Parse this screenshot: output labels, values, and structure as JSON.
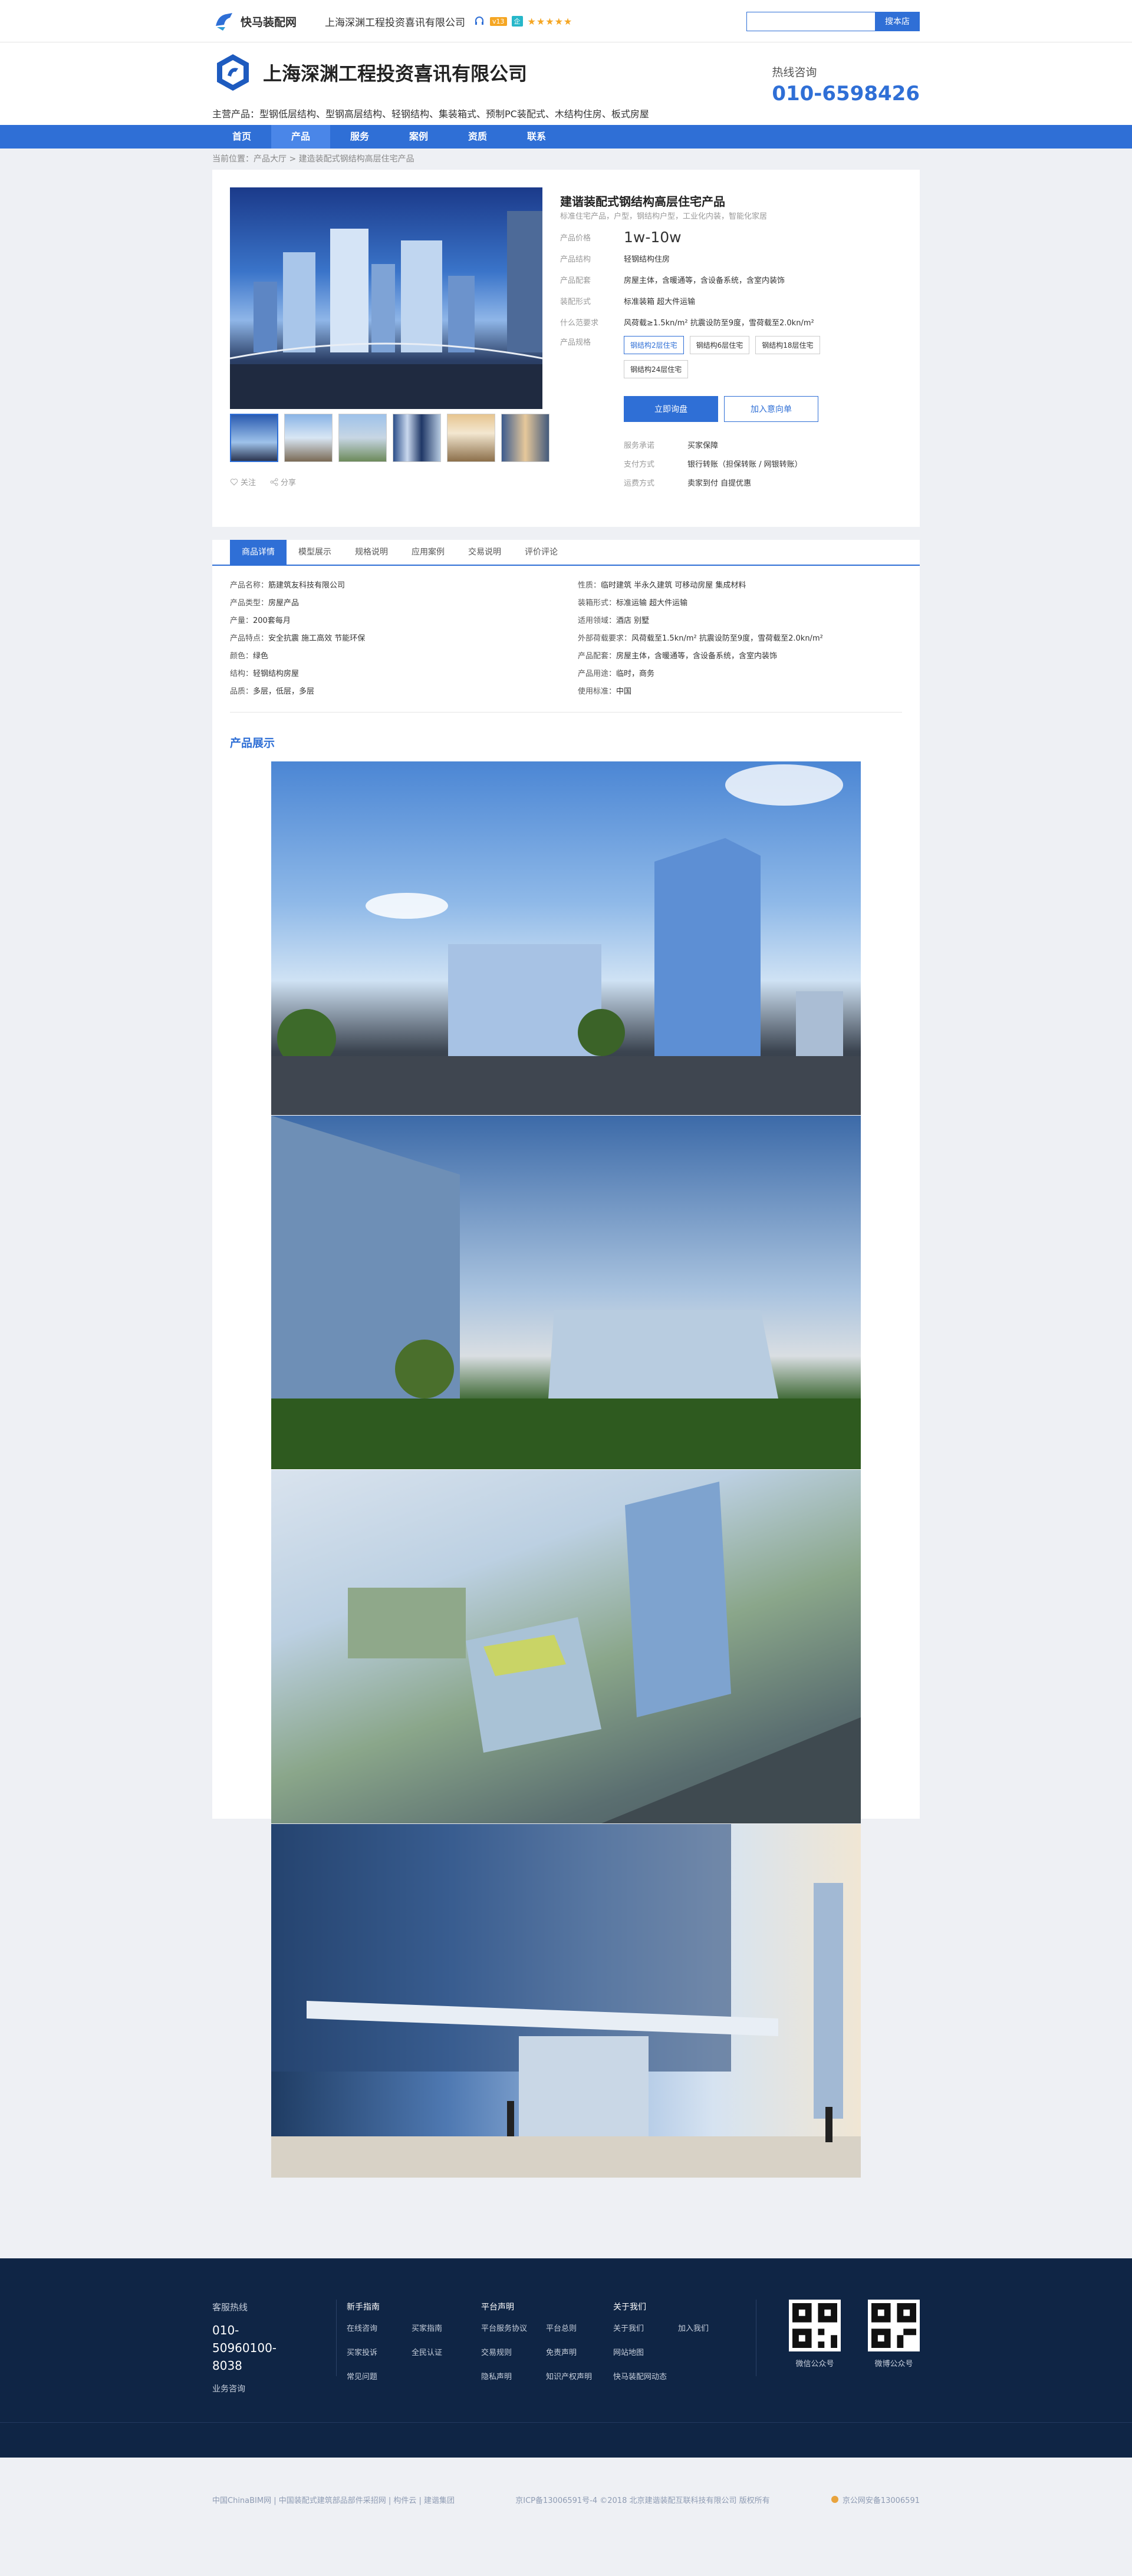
{
  "topbar": {
    "brand": "快马装配网",
    "company": "上海深渊工程投资喜讯有限公司",
    "v_badge": "v13",
    "c_badge": "企",
    "stars": "★★★★★",
    "search_placeholder": "",
    "search_button": "搜本店"
  },
  "header": {
    "company_name": "上海深渊工程投资喜讯有限公司",
    "main_products": "主营产品：型钢低层结构、型钢高层结构、轻钢结构、集装箱式、预制PC装配式、木结构住房、板式房屋",
    "hotline_label": "热线咨询",
    "hotline_number": "010-6598426"
  },
  "nav": [
    "首页",
    "产品",
    "服务",
    "案例",
    "资质",
    "联系"
  ],
  "breadcrumb": "当前位置：产品大厅 > 建造装配式钢结构高层住宅产品",
  "product": {
    "title": "建谐装配式钢结构高层住宅产品",
    "subtitle": "标准住宅产品，户型，钢结构户型，工业化内装，智能化家居",
    "rows": [
      {
        "k": "产品价格",
        "v": "1w-10w"
      },
      {
        "k": "产品结构",
        "v": "轻钢结构住房"
      },
      {
        "k": "产品配套",
        "v": "房屋主体，含暖通等，含设备系统，含室内装饰"
      },
      {
        "k": "装配形式",
        "v": "标准装箱   超大件运输"
      },
      {
        "k": "什么范要求",
        "v": "风荷载≥1.5kn/m²  抗震设防至9度，雪荷载至2.0kn/m²"
      }
    ],
    "spec_label": "产品规格",
    "specs": [
      "钢结构2层住宅",
      "钢结构6层住宅",
      "钢结构18层住宅",
      "钢结构24层住宅"
    ],
    "btn_contact": "立即询盘",
    "btn_cart": "加入意向单",
    "service": [
      {
        "k": "服务承诺",
        "v": "买家保障"
      },
      {
        "k": "支付方式",
        "v": "银行转账（担保转账 / 网银转账）"
      },
      {
        "k": "运费方式",
        "v": "卖家到付  自提优惠"
      }
    ],
    "follow": "关注",
    "share": "分享"
  },
  "tabs": [
    "商品详情",
    "模型展示",
    "规格说明",
    "应用案例",
    "交易说明",
    "评价评论"
  ],
  "attrs": [
    {
      "k": "产品名称：",
      "v": "筋建筑友科技有限公司"
    },
    {
      "k": "性质：",
      "v": "临时建筑  半永久建筑  可移动房屋  集成材料"
    },
    {
      "k": "产品类型：",
      "v": "房屋产品"
    },
    {
      "k": "装箱形式：",
      "v": "标准运输  超大件运输"
    },
    {
      "k": "产量：",
      "v": "200套每月"
    },
    {
      "k": "适用领域：",
      "v": "酒店  别墅"
    },
    {
      "k": "产品特点：",
      "v": "安全抗震  施工高效  节能环保"
    },
    {
      "k": "外部荷载要求：",
      "v": "风荷载至1.5kn/m²  抗震设防至9度，雪荷载至2.0kn/m²"
    },
    {
      "k": "颜色：",
      "v": "绿色"
    },
    {
      "k": "产品配套：",
      "v": "房屋主体，含暖通等，含设备系统，含室内装饰"
    },
    {
      "k": "结构：",
      "v": "轻钢结构房屋"
    },
    {
      "k": "产品用途：",
      "v": "临时，商务"
    },
    {
      "k": "品质：",
      "v": "多层，低层，多层"
    },
    {
      "k": "使用标准：",
      "v": "中国"
    }
  ],
  "section_title": "产品展示",
  "footer": {
    "hotline_label": "客服热线",
    "hotline_number": "010-50960100-8038",
    "consult": "业务咨询",
    "groups": [
      {
        "title": "新手指南",
        "items": [
          "在线咨询",
          "买家指南",
          "买家投诉",
          "全民认证",
          "常见问题"
        ]
      },
      {
        "title": "平台声明",
        "items": [
          "平台服务协议",
          "平台总则",
          "交易规则",
          "免责声明",
          "隐私声明",
          "知识产权声明"
        ]
      },
      {
        "title": "关于我们",
        "items": [
          "关于我们",
          "加入我们",
          "网站地图",
          "快马装配网动态"
        ]
      }
    ],
    "qr": [
      "微信公众号",
      "微博公众号"
    ],
    "bottom_left": "中国ChinaBIM网 | 中国装配式建筑部品部件采招网 | 构件云 | 建谐集团",
    "bottom_mid": "京ICP备13006591号-4  ©2018 北京建谐装配互联科技有限公司 版权所有",
    "bottom_right": "京公网安备13006591"
  }
}
